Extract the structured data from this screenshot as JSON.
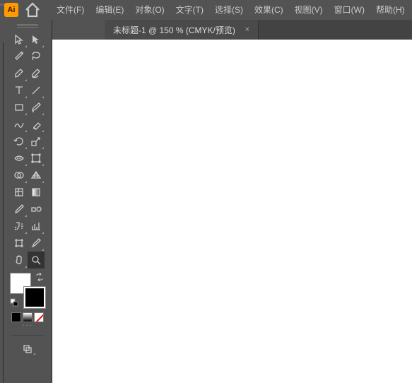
{
  "app": {
    "logo_text": "Ai"
  },
  "menu": {
    "file": "文件(F)",
    "edit": "编辑(E)",
    "object": "对象(O)",
    "type": "文字(T)",
    "select": "选择(S)",
    "effect": "效果(C)",
    "view": "视图(V)",
    "window": "窗口(W)",
    "help": "帮助(H)"
  },
  "tab": {
    "title": "未标题-1 @ 150 % (CMYK/预览)",
    "close_glyph": "×"
  },
  "panel": {
    "collapse_glyph": "‹‹"
  },
  "colors": {
    "fill": "#ffffff",
    "stroke": "#000000"
  }
}
